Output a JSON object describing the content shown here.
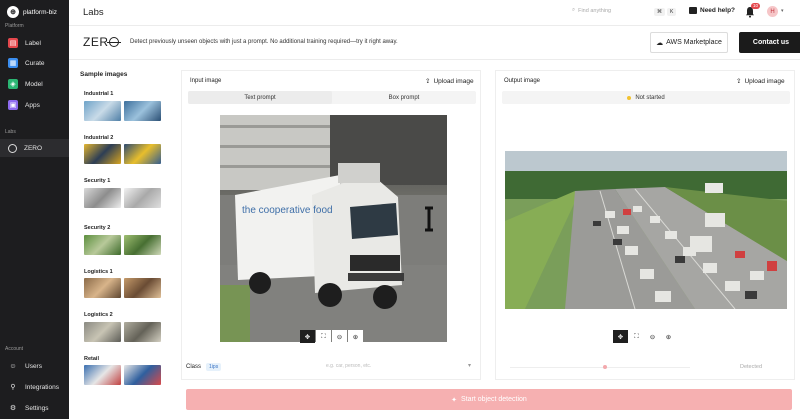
{
  "brand": {
    "name": "platform-biz",
    "logo_letter": "⊕"
  },
  "sidebar": {
    "platform_label": "Platform",
    "items": [
      {
        "label": "Label",
        "icon": "label-icon",
        "color": "#e5484d"
      },
      {
        "label": "Curate",
        "icon": "curate-icon",
        "color": "#3b8ef0"
      },
      {
        "label": "Model",
        "icon": "model-icon",
        "color": "#2bb673"
      },
      {
        "label": "Apps",
        "icon": "apps-icon",
        "color": "#8f6bf0"
      }
    ],
    "labs_label": "Labs",
    "labs_items": [
      {
        "label": "ZERO",
        "icon": "zero-icon"
      }
    ],
    "account_label": "Account",
    "account_items": [
      {
        "label": "Users",
        "icon": "users-icon"
      },
      {
        "label": "Integrations",
        "icon": "integrations-icon"
      },
      {
        "label": "Settings",
        "icon": "settings-icon"
      }
    ]
  },
  "topbar": {
    "title": "Labs",
    "search_placeholder": "Find anything",
    "shortcut": [
      "⌘",
      "K"
    ],
    "help_label": "Need help?",
    "notification_count": "10",
    "avatar_initial": "H"
  },
  "header": {
    "logo_text_left": "ZER",
    "description": "Detect previously unseen objects with just a prompt. No additional training required—try it right away.",
    "aws_button": "AWS Marketplace",
    "contact_button": "Contact us"
  },
  "samples": {
    "title": "Sample images",
    "categories": [
      {
        "label": "Industrial 1"
      },
      {
        "label": "Industrial 2"
      },
      {
        "label": "Security 1"
      },
      {
        "label": "Security 2"
      },
      {
        "label": "Logistics 1"
      },
      {
        "label": "Logistics 2"
      },
      {
        "label": "Retail"
      }
    ]
  },
  "input_panel": {
    "title": "Input image",
    "upload_label": "Upload image",
    "tabs": [
      "Text prompt",
      "Box prompt"
    ]
  },
  "output_panel": {
    "title": "Output image",
    "upload_label": "Upload image",
    "status": "Not started"
  },
  "truck": {
    "brand_text": "the cooperative food"
  },
  "class_row": {
    "label": "Class",
    "chip": "1ips",
    "input_placeholder": "e.g. car, person, etc."
  },
  "detected_label": "Detected",
  "start_button": "Start object detection",
  "colors": {
    "accent": "#e5484d",
    "start_button": "#f6b0b1"
  }
}
